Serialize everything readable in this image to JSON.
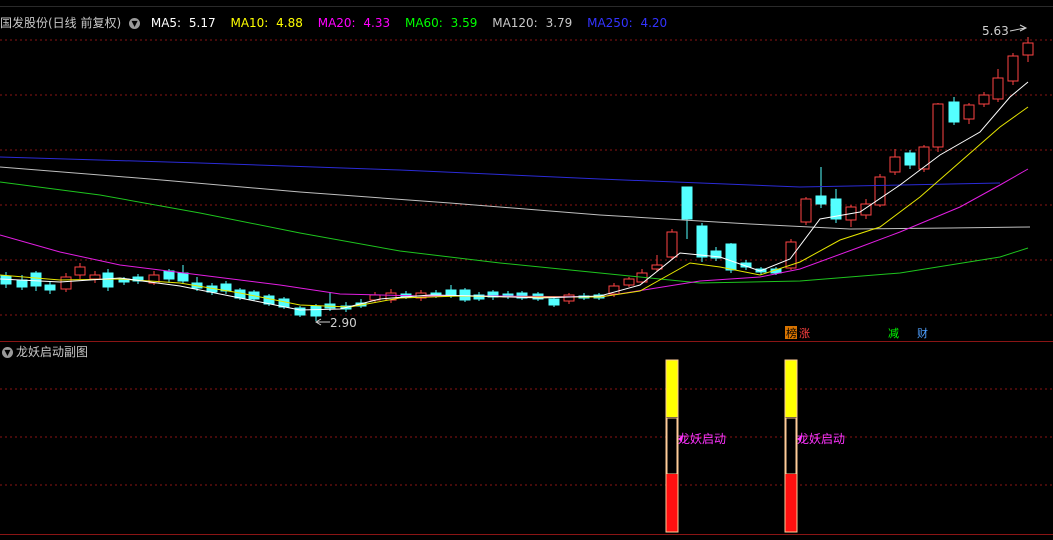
{
  "header": {
    "stock_title": "国发股份(日线 前复权)",
    "ma": [
      {
        "label": "MA5:",
        "value": "5.17",
        "color": "#ffffff"
      },
      {
        "label": "MA10:",
        "value": "4.88",
        "color": "#ffff00"
      },
      {
        "label": "MA20:",
        "value": "4.33",
        "color": "#ff00ff"
      },
      {
        "label": "MA60:",
        "value": "3.59",
        "color": "#00ff00"
      },
      {
        "label": "MA120:",
        "value": "3.79",
        "color": "#c8c8c8"
      },
      {
        "label": "MA250:",
        "value": "4.20",
        "color": "#3333ff"
      }
    ]
  },
  "price_annotations": {
    "high": "5.63",
    "low": "2.90"
  },
  "markers": [
    {
      "text": "榜",
      "color": "#ff8800",
      "bg": "#ff8800"
    },
    {
      "text": "涨",
      "color": "#ff4040"
    },
    {
      "text": "减",
      "color": "#00ff00"
    },
    {
      "text": "财",
      "color": "#4fa0ff"
    }
  ],
  "subchart": {
    "title": "龙妖启动副图",
    "signal_label": "龙妖启动",
    "signal_color": "#ff33ff"
  },
  "colors": {
    "up": "#ff4444",
    "down": "#54ffff",
    "grid": "#8a1515"
  }
}
